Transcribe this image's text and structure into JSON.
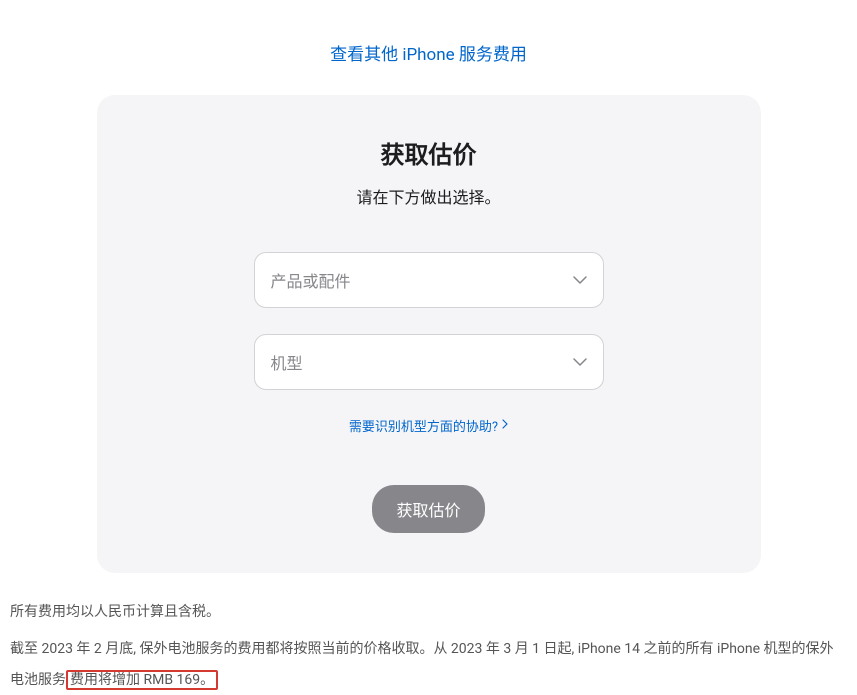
{
  "topLink": {
    "label": "查看其他 iPhone 服务费用"
  },
  "card": {
    "title": "获取估价",
    "subtitle": "请在下方做出选择。",
    "select1": {
      "placeholder": "产品或配件"
    },
    "select2": {
      "placeholder": "机型"
    },
    "helpLink": "需要识别机型方面的协助?",
    "submitLabel": "获取估价"
  },
  "footer": {
    "line1": "所有费用均以人民币计算且含税。",
    "line2_part1": "截至 2023 年 2 月底, 保外电池服务的费用都将按照当前的价格收取。从 2023 年 3 月 1 日起, iPhone 14 之前的所有 iPhone 机型的保外电池服务",
    "line2_highlight": "费用将增加 RMB 169。"
  }
}
